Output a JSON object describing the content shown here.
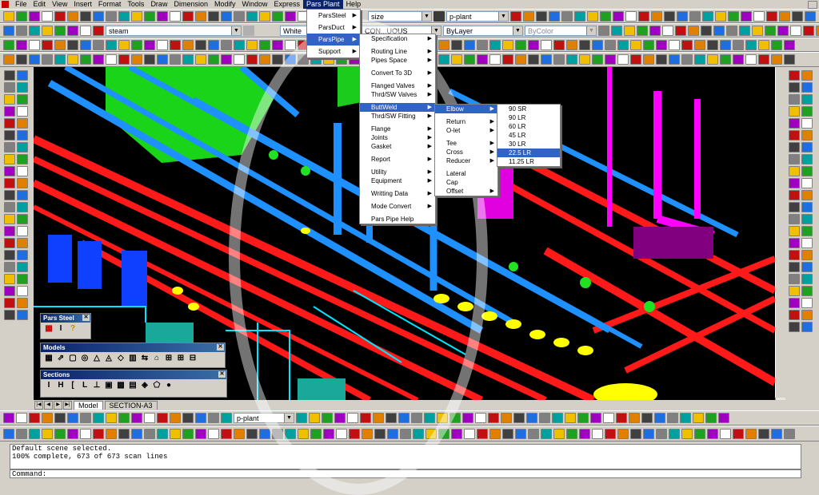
{
  "menubar": {
    "items": [
      "File",
      "Edit",
      "View",
      "Insert",
      "Format",
      "Tools",
      "Draw",
      "Dimension",
      "Modify",
      "Window",
      "Express",
      "Pars Plant",
      "Help"
    ],
    "active": "Pars Plant"
  },
  "toolbars": {
    "dimstyle_combo": "size",
    "layer_combo": "p-plant",
    "current_layer": "steam",
    "color_combo": "White",
    "linetype_combo": "CON...UOUS",
    "lineweight_combo": "ByLayer",
    "plotstyle_combo": "ByColor",
    "bottom_layer_combo": "p-plant"
  },
  "pars_plant_menu": [
    "ParsSteel",
    "ParsDuct",
    "ParsPipe",
    "Support"
  ],
  "parspipe_menu": {
    "groups": [
      [
        "Specification"
      ],
      [
        "Routing Line",
        "Pipes Space"
      ],
      [
        "Convert To 3D"
      ],
      [
        "Flanged Valves",
        "Thrd/SW Valves"
      ],
      [
        "ButtWeld",
        "Thrd/SW Fitting"
      ],
      [
        "Flange",
        "Joints",
        "Gasket"
      ],
      [
        "Report"
      ],
      [
        "Utility",
        "Equipment"
      ],
      [
        "Writting Data"
      ],
      [
        "Mode Convert"
      ],
      [
        "Pars Pipe Help"
      ]
    ],
    "highlighted": "ButtWeld"
  },
  "buttweld_menu": {
    "groups": [
      [
        "Elbow"
      ],
      [
        "Return",
        "O-let"
      ],
      [
        "Tee",
        "Cross",
        "Reducer"
      ],
      [
        "Lateral",
        "Cap",
        "Offset"
      ]
    ],
    "highlighted": "Elbow"
  },
  "elbow_menu": {
    "items": [
      "90 SR",
      "90 LR",
      "60 LR",
      "45 LR",
      "30 LR",
      "22.5 LR",
      "11.25 LR"
    ],
    "highlighted": "22.5 LR"
  },
  "palettes": {
    "pars_steel": "Pars Steel",
    "models": "Models",
    "sections": "Sections",
    "sections_glyphs": [
      "I",
      "H",
      "[",
      "L",
      "⊥"
    ]
  },
  "tabs": [
    "Model",
    "SECTION-A3"
  ],
  "command": {
    "history": [
      "Default scene selected.",
      "100% complete, 673 of 673 scan lines"
    ],
    "prompt": "Command:"
  },
  "colors": {
    "pipe_blue": "#1e90ff",
    "pipe_red": "#ff1a1a",
    "pipe_green": "#22e022",
    "pipe_magenta": "#ff00ff",
    "pipe_yellow": "#ffff00",
    "menu_highlight": "#3163c5",
    "title_blue": "#0a246a"
  }
}
